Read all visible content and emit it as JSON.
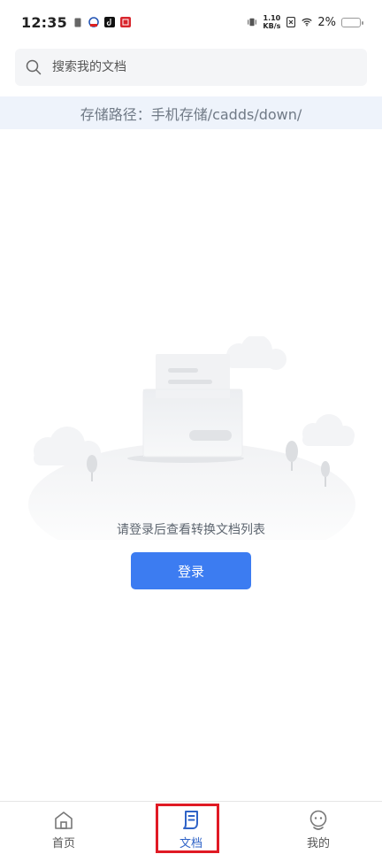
{
  "status_bar": {
    "time": "12:35",
    "net_speed_value": "1.10",
    "net_speed_unit": "KB/s",
    "battery_percent": "2%"
  },
  "search": {
    "placeholder": "搜索我的文档"
  },
  "path_banner": {
    "text": "存储路径：手机存储/cadds/down/"
  },
  "empty_state": {
    "message": "请登录后查看转换文档列表",
    "login_label": "登录"
  },
  "bottom_nav": {
    "items": [
      {
        "label": "首页",
        "icon": "home-icon",
        "active": false
      },
      {
        "label": "文档",
        "icon": "document-icon",
        "active": true
      },
      {
        "label": "我的",
        "icon": "profile-icon",
        "active": false
      }
    ]
  },
  "colors": {
    "accent": "#3c7cf1",
    "active_nav": "#2f63c7",
    "highlight": "#e01a24",
    "banner_bg": "#eef3fb"
  }
}
